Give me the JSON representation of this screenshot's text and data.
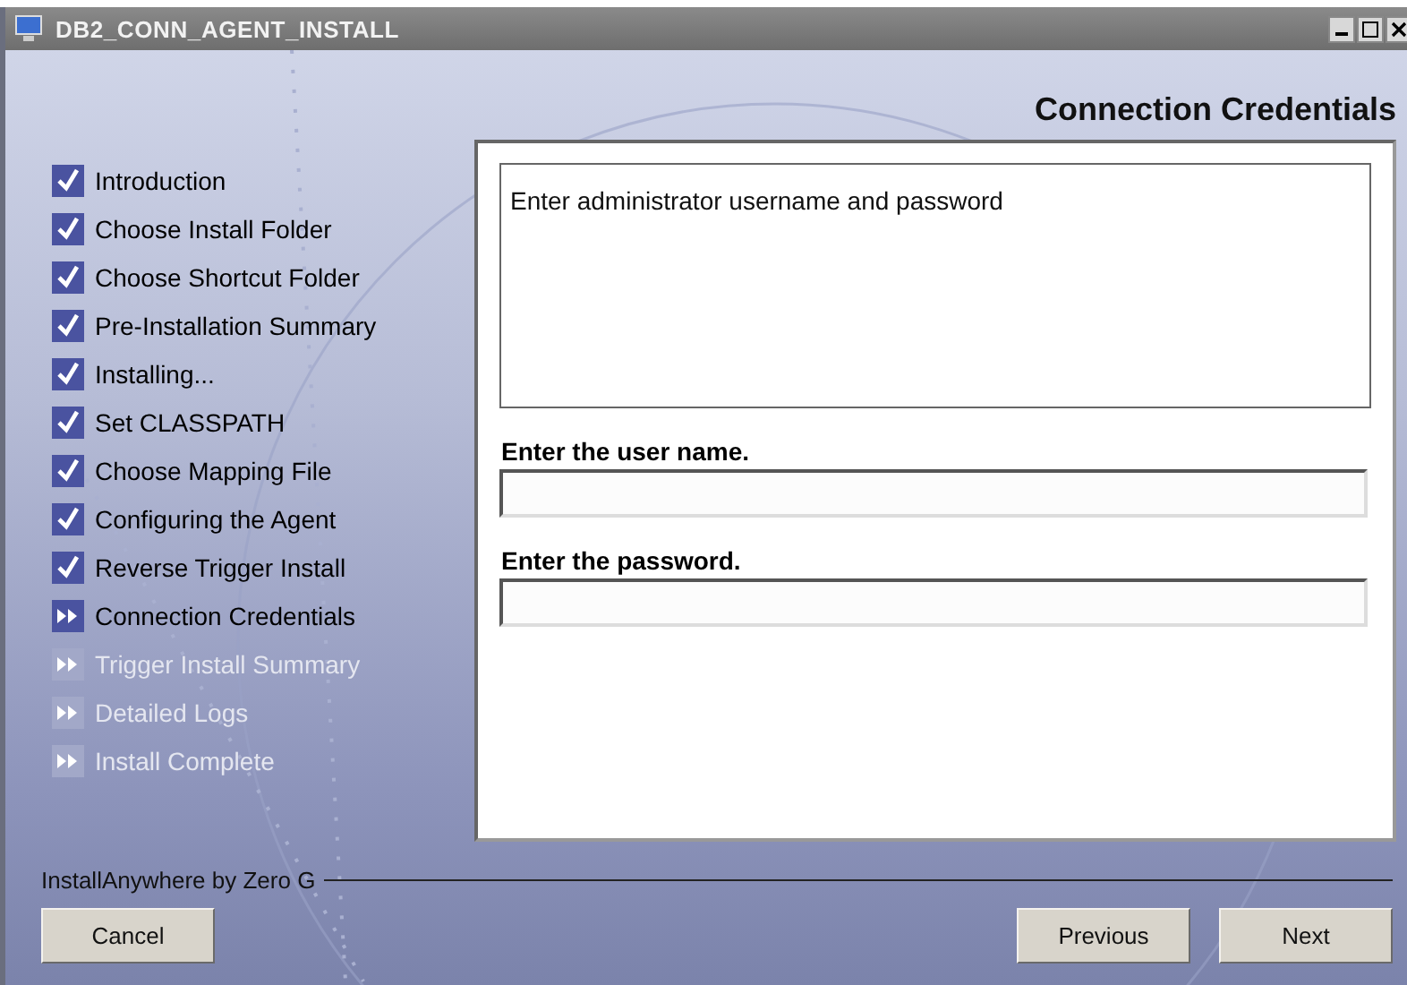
{
  "window": {
    "title": "DB2_CONN_AGENT_INSTALL"
  },
  "header": {
    "title": "Connection Credentials"
  },
  "steps": [
    {
      "label": "Introduction",
      "kind": "done"
    },
    {
      "label": "Choose Install Folder",
      "kind": "done"
    },
    {
      "label": "Choose Shortcut Folder",
      "kind": "done"
    },
    {
      "label": "Pre-Installation Summary",
      "kind": "done"
    },
    {
      "label": "Installing...",
      "kind": "done"
    },
    {
      "label": "Set CLASSPATH",
      "kind": "done"
    },
    {
      "label": "Choose Mapping File",
      "kind": "done"
    },
    {
      "label": "Configuring the Agent",
      "kind": "done"
    },
    {
      "label": "Reverse Trigger Install",
      "kind": "done"
    },
    {
      "label": "Connection Credentials",
      "kind": "current"
    },
    {
      "label": "Trigger Install Summary",
      "kind": "pending"
    },
    {
      "label": "Detailed Logs",
      "kind": "pending"
    },
    {
      "label": "Install Complete",
      "kind": "pending"
    }
  ],
  "description": "Enter administrator username and password",
  "fields": [
    {
      "label": "Enter the user name."
    },
    {
      "label": "Enter the password."
    }
  ],
  "footer": {
    "brand": "InstallAnywhere by Zero G"
  },
  "buttons": {
    "cancel": "Cancel",
    "previous": "Previous",
    "next": "Next"
  }
}
